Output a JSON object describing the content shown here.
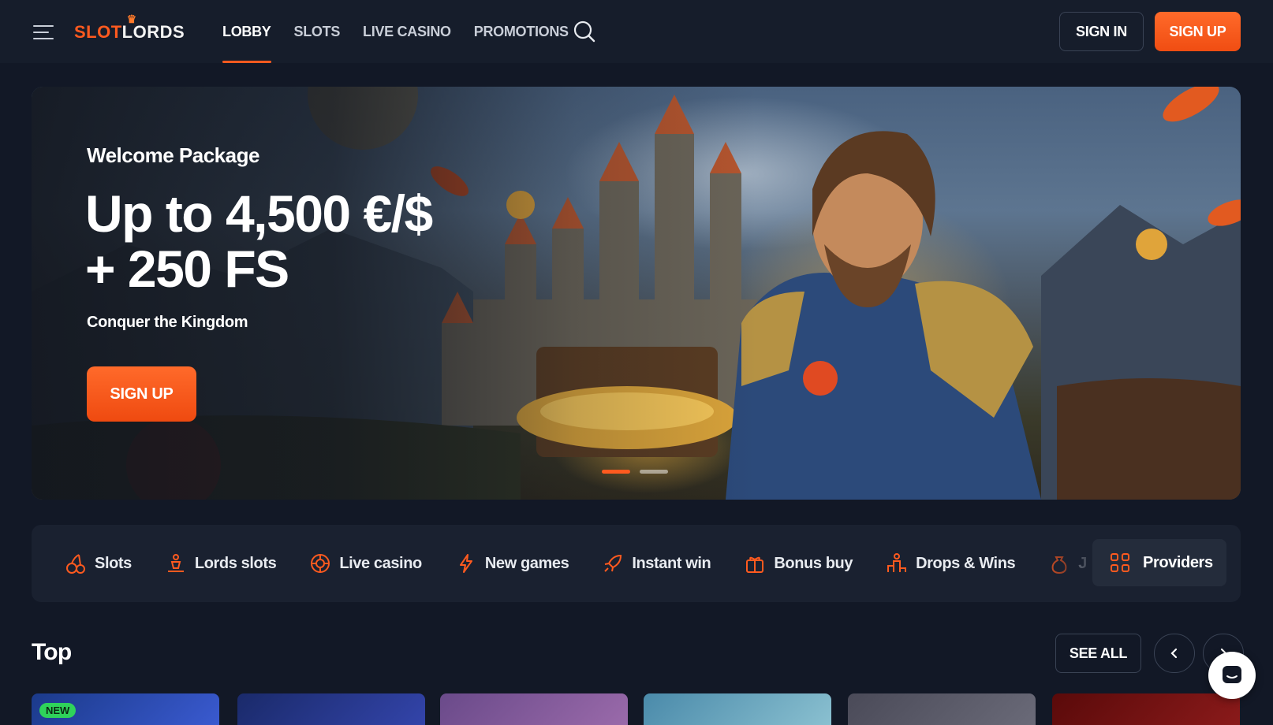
{
  "header": {
    "logo_part1": "SLOT",
    "logo_part2": "LORDS",
    "nav": [
      {
        "label": "LOBBY",
        "active": true
      },
      {
        "label": "SLOTS",
        "active": false
      },
      {
        "label": "LIVE CASINO",
        "active": false
      },
      {
        "label": "PROMOTIONS",
        "active": false
      }
    ],
    "signin_label": "SIGN IN",
    "signup_label": "SIGN UP",
    "accent": "#ff5a1f"
  },
  "hero": {
    "kicker": "Welcome Package",
    "title_line1": "Up to 4,500 €/$",
    "title_line2": "+ 250 FS",
    "subtitle": "Conquer the Kingdom",
    "cta_label": "SIGN UP",
    "slides": 2,
    "active_slide": 1
  },
  "categories": {
    "items": [
      {
        "label": "Slots",
        "icon": "cherries-icon"
      },
      {
        "label": "Lords slots",
        "icon": "throne-icon"
      },
      {
        "label": "Live casino",
        "icon": "chip-icon"
      },
      {
        "label": "New games",
        "icon": "lightning-icon"
      },
      {
        "label": "Instant win",
        "icon": "rocket-icon"
      },
      {
        "label": "Bonus buy",
        "icon": "gift-icon"
      },
      {
        "label": "Drops & Wins",
        "icon": "podium-icon"
      },
      {
        "label": "J",
        "icon": "money-bag-icon"
      }
    ],
    "providers_label": "Providers"
  },
  "top": {
    "title": "Top",
    "see_all_label": "SEE ALL",
    "new_badge": "NEW"
  }
}
